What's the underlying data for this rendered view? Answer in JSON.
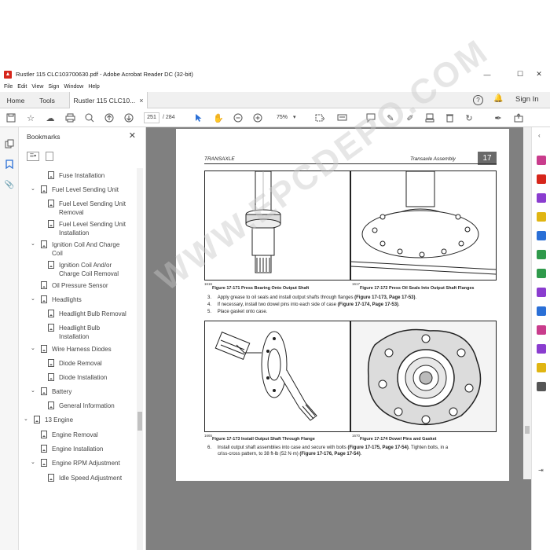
{
  "window": {
    "title": "Rustler 115 CLC103700630.pdf - Adobe Acrobat Reader DC (32-bit)",
    "minimize": "—",
    "maximize": "☐",
    "close": "✕"
  },
  "menu": [
    "File",
    "Edit",
    "View",
    "Sign",
    "Window",
    "Help"
  ],
  "tabs": {
    "home": "Home",
    "tools": "Tools",
    "document": "Rustler 115 CLC10...",
    "close": "×",
    "signin": "Sign In"
  },
  "toolbar": {
    "page_current": "251",
    "page_total": "/ 284",
    "zoom": "75%"
  },
  "bookmarks": {
    "header": "Bookmarks",
    "items": [
      {
        "label": "Fuse Installation"
      },
      {
        "label": "Fuel Level Sending Unit"
      },
      {
        "label": "Fuel Level Sending Unit Removal"
      },
      {
        "label": "Fuel Level Sending Unit Installation"
      },
      {
        "label": "Ignition Coil And Charge Coil"
      },
      {
        "label": "Ignition Coil And/or Charge Coil Removal"
      },
      {
        "label": "Oil Pressure Sensor"
      },
      {
        "label": "Headlights"
      },
      {
        "label": "Headlight Bulb Removal"
      },
      {
        "label": "Headlight Bulb Installation"
      },
      {
        "label": "Wire Harness Diodes"
      },
      {
        "label": "Diode Removal"
      },
      {
        "label": "Diode Installation"
      },
      {
        "label": "Battery"
      },
      {
        "label": "General Information"
      },
      {
        "label": "13 Engine"
      },
      {
        "label": "Engine Removal"
      },
      {
        "label": "Engine Installation"
      },
      {
        "label": "Engine RPM Adjustment"
      },
      {
        "label": "Idle Speed Adjustment"
      }
    ]
  },
  "document": {
    "header_left": "TRANSAXLE",
    "header_right": "Transaxle Assembly",
    "page_number": "17",
    "figures": [
      {
        "code": "1616",
        "caption": "Figure 17-171     Press Bearing Onto Output Shaft"
      },
      {
        "code": "1617",
        "caption": "Figure 17-172     Press Oil Seals Into Output Shaft Flanges"
      },
      {
        "code": "1665",
        "caption": "Figure 17-173     Install Output Shaft Through Flange"
      },
      {
        "code": "1670",
        "caption": "Figure 17-174     Dowel Pins and Gasket"
      }
    ],
    "steps": [
      {
        "num": "3.",
        "text": "Apply grease to oil seals and install output shafts through flanges ",
        "ref": "(Figure 17-173, Page 17-53)",
        "end": "."
      },
      {
        "num": "4.",
        "text": "If necessary, install two dowel pins into each side of case ",
        "ref": "(Figure 17-174, Page 17-53)",
        "end": "."
      },
      {
        "num": "5.",
        "text": "Place gasket onto case.",
        "ref": "",
        "end": ""
      },
      {
        "num": "6.",
        "text": "Install output shaft assemblies into case and secure with bolts ",
        "ref": "(Figure 17-175, Page 17-54)",
        "end": ".  Tighten bolts, in a"
      },
      {
        "num": "",
        "text": "criss-cross pattern, to 38 ft-lb (52 N·m) ",
        "ref": "(Figure 17-176, Page 17-54)",
        "end": "."
      }
    ],
    "watermark": "WWW.EPCDEPO.COM"
  },
  "colors": {
    "acrobat_red": "#d6261b",
    "viewer_bg": "#808080",
    "tools_blue": "#2a6fd6",
    "tools_purple": "#8a3ccf",
    "tools_pink": "#c93c8c",
    "tools_green": "#2f9a4b",
    "tools_yellow": "#e0b512"
  }
}
